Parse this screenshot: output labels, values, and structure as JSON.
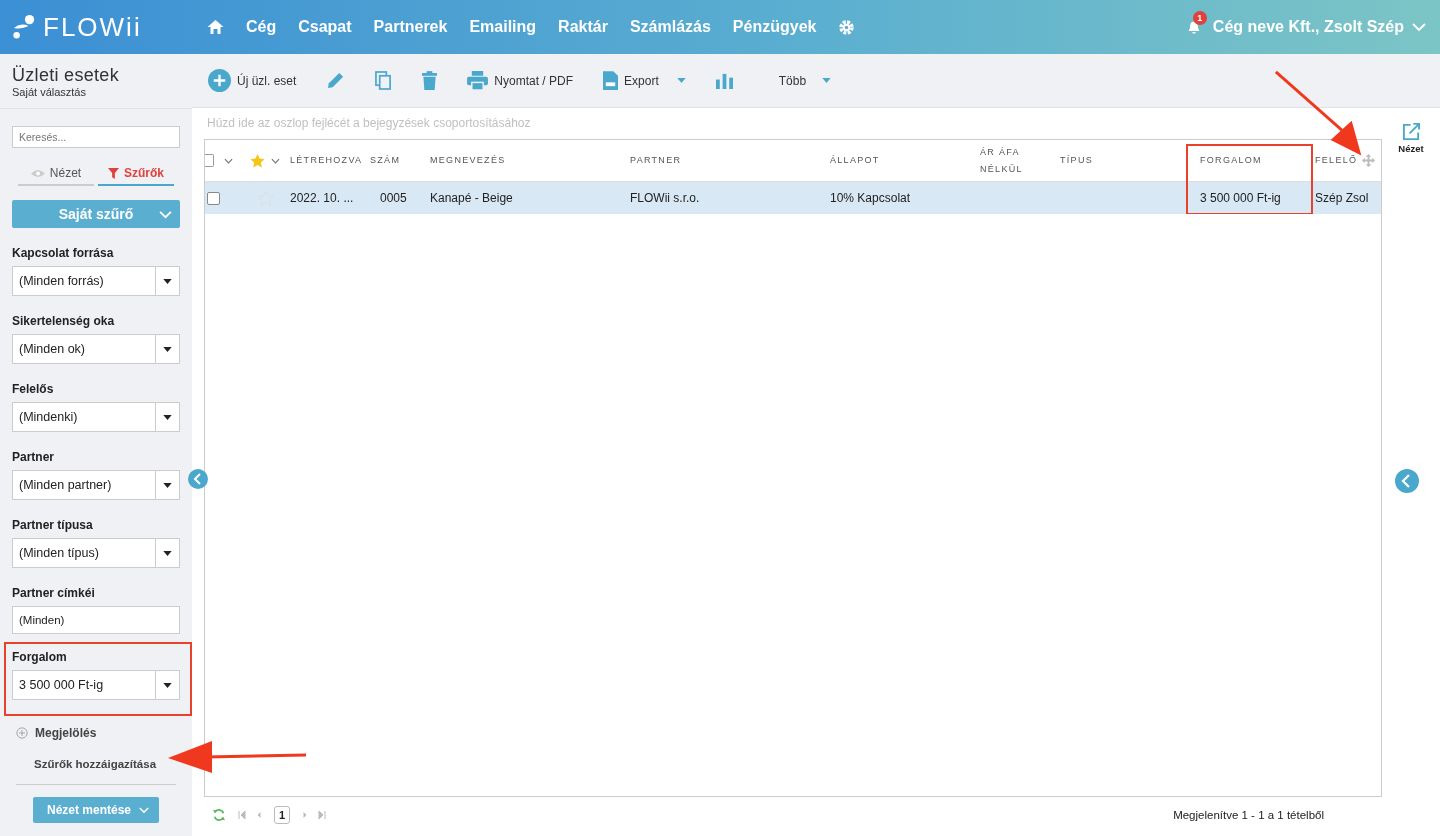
{
  "brand": {
    "name": "FLOWii"
  },
  "nav": [
    "Cég",
    "Csapat",
    "Partnerek",
    "Emailing",
    "Raktár",
    "Számlázás",
    "Pénzügyek"
  ],
  "notifications": {
    "count": "1"
  },
  "user": "Cég neve Kft., Zsolt Szép",
  "page": {
    "title": "Üzleti esetek",
    "subtitle": "Saját választás"
  },
  "toolbar": [
    {
      "kind": "add",
      "label": "Új üzl. eset"
    },
    {
      "kind": "edit"
    },
    {
      "kind": "copy"
    },
    {
      "kind": "delete"
    },
    {
      "kind": "print",
      "label": "Nyomtat / PDF"
    },
    {
      "kind": "export",
      "label": "Export",
      "dropdown": true
    },
    {
      "kind": "chart"
    },
    {
      "kind": "more",
      "label": "Több",
      "dropdown": true
    }
  ],
  "sidebar": {
    "search": {
      "placeholder": "Keresés..."
    },
    "tabs": [
      {
        "label": "Nézet",
        "selected": false
      },
      {
        "label": "Szűrők",
        "selected": true
      }
    ],
    "saved_filter": "Saját szűrő",
    "filters": [
      {
        "label": "Kapcsolat forrása",
        "value": "(Minden forrás)",
        "kind": "select",
        "highlighted": false
      },
      {
        "label": "Sikertelenség oka",
        "value": "(Minden ok)",
        "kind": "select",
        "highlighted": false
      },
      {
        "label": "Felelős",
        "value": "(Mindenki)",
        "kind": "select",
        "highlighted": false
      },
      {
        "label": "Partner",
        "value": "(Minden partner)",
        "kind": "select",
        "highlighted": false
      },
      {
        "label": "Partner típusa",
        "value": "(Minden típus)",
        "kind": "select",
        "highlighted": false
      },
      {
        "label": "Partner címkéi",
        "value": "(Minden)",
        "kind": "text",
        "highlighted": false
      },
      {
        "label": "Forgalom",
        "value": "3 500 000 Ft-ig",
        "kind": "select",
        "highlighted": true
      }
    ],
    "mark_label": "Megjelölés",
    "adjust_link": "Szűrők hozzáigazítása",
    "save_button": "Nézet mentése"
  },
  "grid": {
    "group_hint": "Húzd ide az oszlop fejlécét a bejegyzések csoportosításához",
    "all_checked": false,
    "columns": [
      {
        "label": "LÉTREHOZVA",
        "highlighted": false
      },
      {
        "label": "SZÁM",
        "highlighted": false
      },
      {
        "label": "MEGNEVEZÉS",
        "highlighted": false
      },
      {
        "label": "PARTNER",
        "highlighted": false
      },
      {
        "label": "ÁLLAPOT",
        "highlighted": false
      },
      {
        "label": "ÁR ÁFA NÉLKÜL",
        "highlighted": false
      },
      {
        "label": "TÍPUS",
        "highlighted": false
      },
      {
        "label": "FORGALOM",
        "highlighted": true
      },
      {
        "label": "FELELŐ",
        "highlighted": false
      }
    ],
    "rows": [
      {
        "selected": true,
        "checked": false,
        "starred": false,
        "cells": [
          "2022. 10. ...",
          "0005",
          "Kanapé - Beige",
          "FLOWii s.r.o.",
          "10% Kapcsolat",
          "",
          "",
          "3 500 000 Ft-ig",
          "Szép Zsol"
        ]
      }
    ],
    "pager": {
      "page": "1",
      "summary": "Megjelenítve 1 - 1 a 1 tételből"
    }
  },
  "right_panel": {
    "view_label": "Nézet"
  }
}
